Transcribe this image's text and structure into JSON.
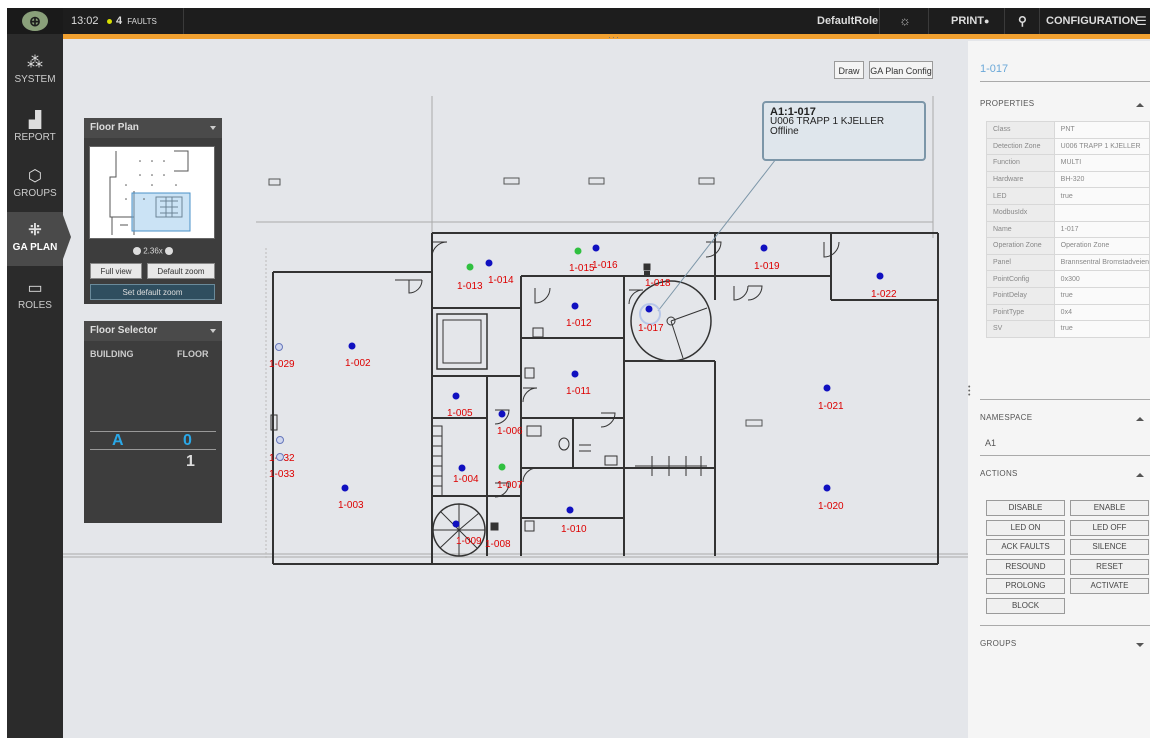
{
  "topbar": {
    "time": "13:02",
    "faults_count": "4",
    "faults_label": "FAULTS",
    "role": "DefaultRole",
    "print_label": "PRINT",
    "config_label": "CONFIGURATION"
  },
  "nav": [
    {
      "label": "SYSTEM",
      "icon": "system-icon"
    },
    {
      "label": "REPORT",
      "icon": "report-icon"
    },
    {
      "label": "GROUPS",
      "icon": "groups-icon"
    },
    {
      "label": "GA PLAN",
      "icon": "ga-plan-icon",
      "active": true
    },
    {
      "label": "ROLES",
      "icon": "roles-icon"
    }
  ],
  "toolbar": {
    "draw_label": "Draw",
    "config_label": "GA Plan Config"
  },
  "floor_plan": {
    "title": "Floor Plan",
    "zoom": "2.36x",
    "full_view": "Full view",
    "default_zoom": "Default zoom",
    "set_default_zoom": "Set default zoom"
  },
  "floor_selector": {
    "title": "Floor Selector",
    "building_header": "BUILDING",
    "floor_header": "FLOOR",
    "building": "A",
    "floor_selected": "0",
    "floor_other": "1"
  },
  "tooltip": {
    "id": "A1:1-017",
    "zone": "U006 TRAPP 1 KJELLER",
    "status": "Offline"
  },
  "plan_points": [
    {
      "label": "1-002",
      "color": "blue"
    },
    {
      "label": "1-003",
      "color": "blue"
    },
    {
      "label": "1-004",
      "color": "blue"
    },
    {
      "label": "1-005",
      "color": "blue"
    },
    {
      "label": "1-006",
      "color": "blue"
    },
    {
      "label": "1-007",
      "color": "green"
    },
    {
      "label": "1-008",
      "color": "square"
    },
    {
      "label": "1-009",
      "color": "blue"
    },
    {
      "label": "1-010",
      "color": "blue"
    },
    {
      "label": "1-011",
      "color": "blue"
    },
    {
      "label": "1-012",
      "color": "blue"
    },
    {
      "label": "1-013",
      "color": "green"
    },
    {
      "label": "1-014",
      "color": "blue"
    },
    {
      "label": "1-015",
      "color": "green"
    },
    {
      "label": "1-016",
      "color": "blue"
    },
    {
      "label": "1-017",
      "color": "blue"
    },
    {
      "label": "1-018",
      "color": "square"
    },
    {
      "label": "1-019",
      "color": "blue"
    },
    {
      "label": "1-020",
      "color": "blue"
    },
    {
      "label": "1-021",
      "color": "blue"
    },
    {
      "label": "1-022",
      "color": "blue"
    },
    {
      "label": "1-029",
      "color": "ring"
    },
    {
      "label": "1-032",
      "color": "ring"
    },
    {
      "label": "1-033",
      "color": "ring"
    }
  ],
  "right_panel": {
    "title": "1-017",
    "properties_label": "PROPERTIES",
    "properties": [
      {
        "key": "Class",
        "value": "PNT"
      },
      {
        "key": "Detection Zone",
        "value": "U006 TRAPP 1 KJELLER"
      },
      {
        "key": "Function",
        "value": "MULTI"
      },
      {
        "key": "Hardware",
        "value": "BH-320"
      },
      {
        "key": "LED",
        "value": "true"
      },
      {
        "key": "ModbusIdx",
        "value": ""
      },
      {
        "key": "Name",
        "value": "1-017"
      },
      {
        "key": "Operation Zone",
        "value": "Operation Zone"
      },
      {
        "key": "Panel",
        "value": "Brannsentral Bromstadveien"
      },
      {
        "key": "PointConfig",
        "value": "0x300"
      },
      {
        "key": "PointDelay",
        "value": "true"
      },
      {
        "key": "PointType",
        "value": "0x4"
      },
      {
        "key": "SV",
        "value": "true"
      }
    ],
    "namespace_label": "NAMESPACE",
    "namespace_value": "A1",
    "actions_label": "ACTIONS",
    "actions": [
      "DISABLE",
      "ENABLE",
      "LED ON",
      "LED OFF",
      "ACK FAULTS",
      "SILENCE",
      "RESOUND",
      "RESET",
      "PROLONG",
      "ACTIVATE",
      "BLOCK"
    ],
    "groups_label": "GROUPS"
  },
  "colors": {
    "accent": "#f0a030",
    "selected_floor": "#2aa8e8",
    "point_blue": "#1010c0",
    "point_green": "#30c040",
    "label_red": "#dd0000"
  }
}
